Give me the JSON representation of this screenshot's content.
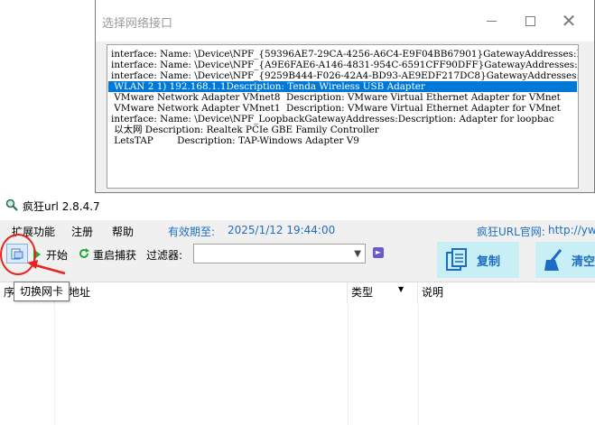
{
  "dialog": {
    "title": "选择网络接口",
    "interfaces": [
      "interface: Name: \\Device\\NPF_{59396AE7-29CA-4256-A6C4-E9F04BB67901}GatewayAddresses:De",
      "interface: Name: \\Device\\NPF_{A9E6FAE6-A146-4831-954C-6591CFF90DFF}GatewayAddresses:De",
      "interface: Name: \\Device\\NPF_{9259B444-F026-42A4-BD93-AE9EDF217DC8}GatewayAddresses:De",
      " WLAN 2 1) 192.168.1.1Description: Tenda Wireless USB Adapter",
      " VMware Network Adapter VMnet8  Description: VMware Virtual Ethernet Adapter for VMnet",
      " VMware Network Adapter VMnet1  Description: VMware Virtual Ethernet Adapter for VMnet",
      "interface: Name: \\Device\\NPF_LoopbackGatewayAddresses:Description: Adapter for loopbac",
      " 以太网 Description: Realtek PCIe GBE Family Controller",
      " LetsTAP        Description: TAP-Windows Adapter V9"
    ],
    "selected_index": 3
  },
  "app": {
    "name": "疯狂url  2.8.4.7",
    "menu": [
      "扩展功能",
      "注册",
      "帮助"
    ],
    "expire_label": "有效期至:",
    "expire_date": "2025/1/12 19:44:00",
    "site_label": "疯狂URL官网:",
    "site_url": "http://yw",
    "toolbar": {
      "start_label": "开始",
      "restart_label": "重启捕获",
      "filter_label": "过滤器:",
      "filter_value": "",
      "copy_label": "复制",
      "clear_label": "清空"
    },
    "table": {
      "columns": [
        "序",
        "址地址",
        "类型",
        "说明"
      ]
    },
    "tooltip": "切换网卡"
  },
  "colors": {
    "selection": "#0078d7",
    "link_blue": "#1f6fc0",
    "button_bg": "#c8eef6",
    "annotation_red": "#e8231c"
  }
}
